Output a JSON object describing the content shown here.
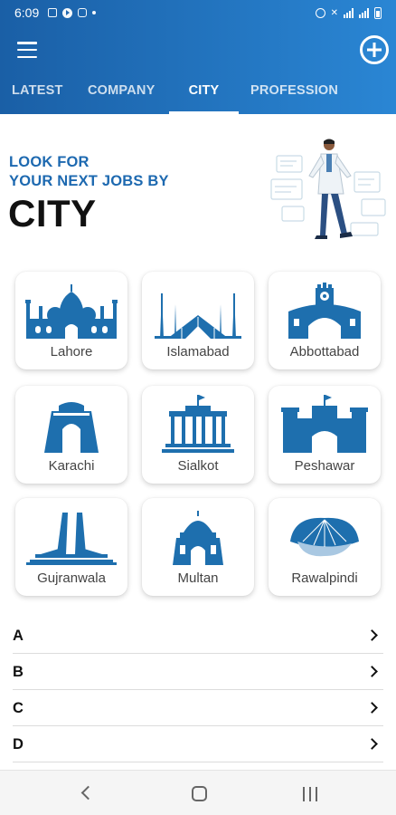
{
  "status_bar": {
    "time": "6:09",
    "left_icons": [
      "gallery-icon",
      "play-icon",
      "instagram-icon"
    ],
    "right_icons": [
      "alarm-icon",
      "mute-icon",
      "lte-signal-icon",
      "signal-icon",
      "battery-icon"
    ]
  },
  "header": {
    "menu_icon": "menu-icon",
    "add_icon": "add-circle-icon",
    "tabs": [
      {
        "label": "LATEST",
        "active": false
      },
      {
        "label": "COMPANY",
        "active": false
      },
      {
        "label": "CITY",
        "active": true
      },
      {
        "label": "PROFESSION",
        "active": false
      }
    ]
  },
  "hero": {
    "line1": "LOOK FOR",
    "line2": "YOUR NEXT JOBS BY",
    "title": "CITY"
  },
  "cities": [
    {
      "name": "Lahore",
      "icon": "badshahi-mosque-icon"
    },
    {
      "name": "Islamabad",
      "icon": "faisal-mosque-icon"
    },
    {
      "name": "Abbottabad",
      "icon": "clock-tower-gate-icon"
    },
    {
      "name": "Karachi",
      "icon": "mazar-e-quaid-icon"
    },
    {
      "name": "Sialkot",
      "icon": "colonnade-building-icon"
    },
    {
      "name": "Peshawar",
      "icon": "bab-e-khyber-icon"
    },
    {
      "name": "Gujranwala",
      "icon": "monument-icon"
    },
    {
      "name": "Multan",
      "icon": "tomb-icon"
    },
    {
      "name": "Rawalpindi",
      "icon": "canopy-monument-icon"
    }
  ],
  "alphabet_list": [
    "A",
    "B",
    "C",
    "D"
  ],
  "colors": {
    "header_start": "#1a5fa6",
    "header_end": "#2a86d4",
    "accent": "#1d69b0",
    "icon_blue": "#1e6fae"
  },
  "nav_bar": [
    "back-icon",
    "home-icon",
    "recents-icon"
  ]
}
